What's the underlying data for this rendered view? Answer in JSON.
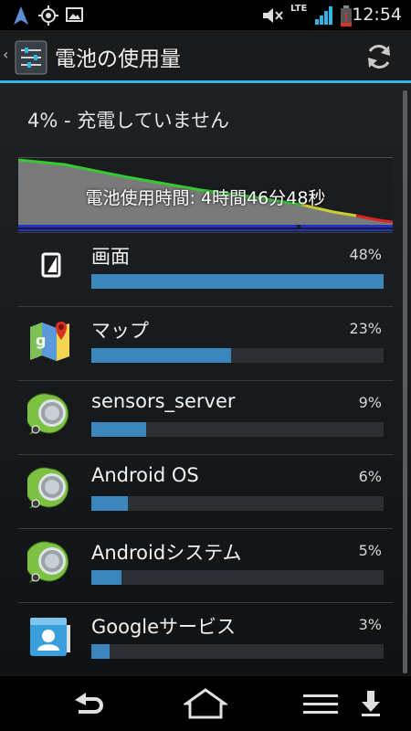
{
  "status_bar": {
    "time": "12:54",
    "network": "LTE",
    "icons": [
      "navigation-icon",
      "gps-icon",
      "image-icon",
      "mute-icon",
      "signal-icon",
      "battery-icon"
    ]
  },
  "action_bar": {
    "title": "電池の使用量",
    "back_icon": "chevron-left-icon",
    "app_icon": "settings-icon",
    "refresh_icon": "refresh-icon",
    "accent_color": "#35b5e5"
  },
  "battery": {
    "status": "4% - 充電していません",
    "usage_time": "電池使用時間: 4時間46分48秒",
    "level_start_pct": 100,
    "level_end_pct": 4
  },
  "items": [
    {
      "name": "画面",
      "percent_label": "48%",
      "percent": 48,
      "icon": "screen-icon"
    },
    {
      "name": "マップ",
      "percent_label": "23%",
      "percent": 23,
      "icon": "maps-icon"
    },
    {
      "name": "sensors_server",
      "percent_label": "9%",
      "percent": 9,
      "icon": "android-system-icon"
    },
    {
      "name": "Android OS",
      "percent_label": "6%",
      "percent": 6,
      "icon": "android-system-icon"
    },
    {
      "name": "Androidシステム",
      "percent_label": "5%",
      "percent": 5,
      "icon": "android-system-icon"
    },
    {
      "name": "Googleサービス",
      "percent_label": "3%",
      "percent": 3,
      "icon": "contacts-icon"
    }
  ],
  "nav_bar": {
    "buttons": [
      "back-icon",
      "home-icon",
      "menu-icon",
      "download-icon"
    ]
  }
}
